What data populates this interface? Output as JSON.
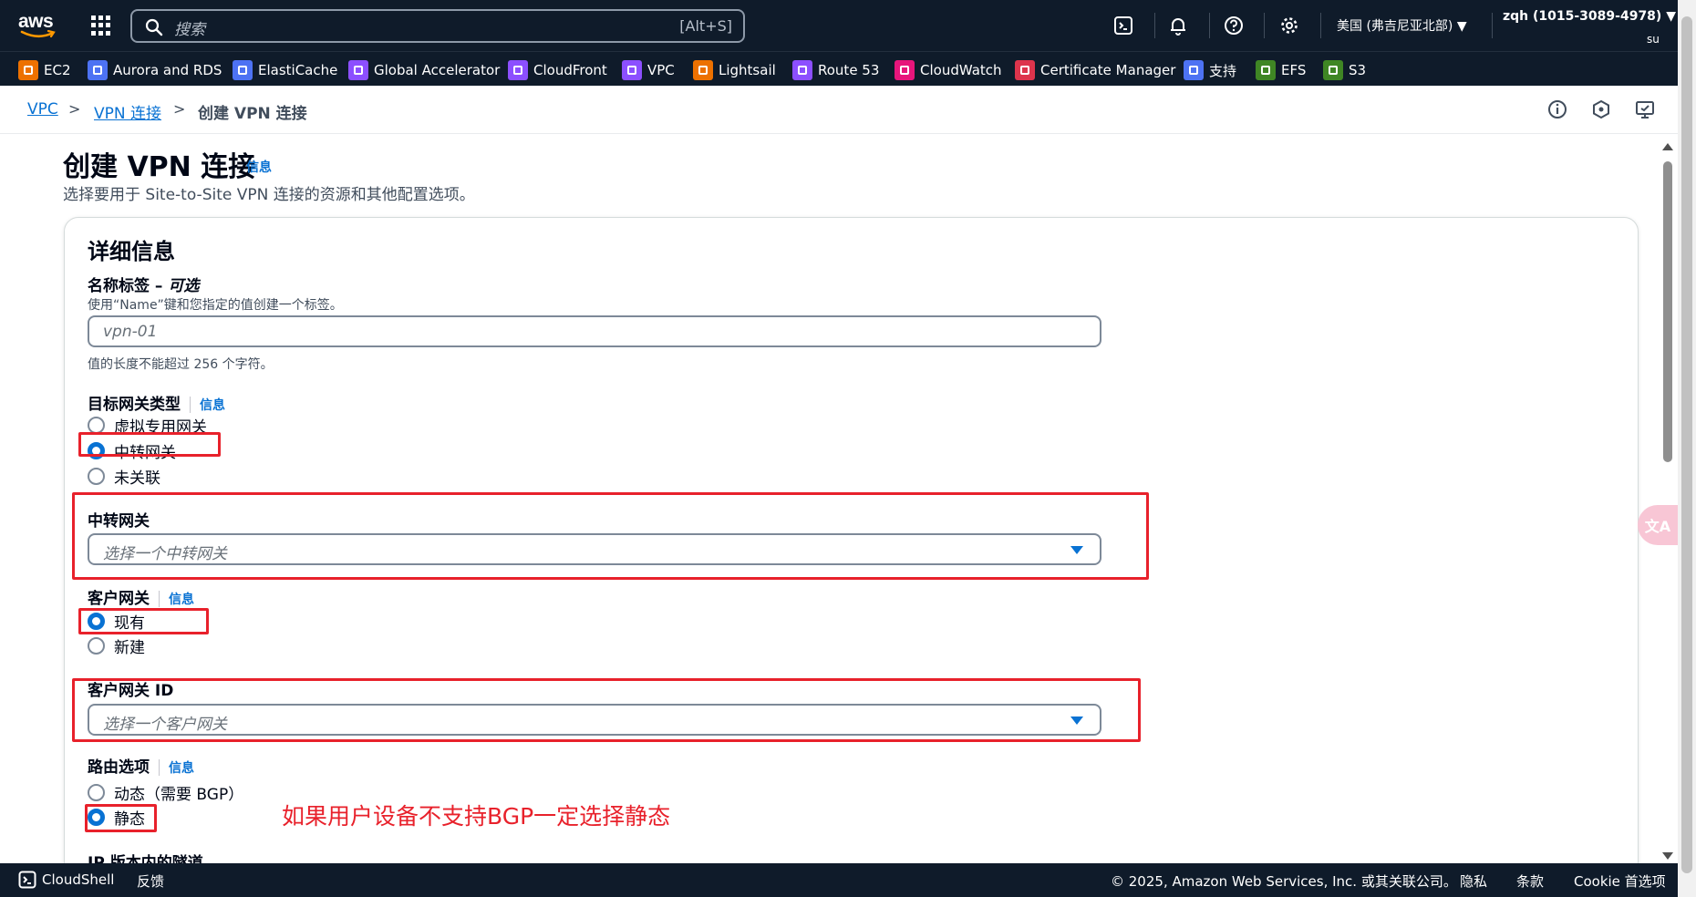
{
  "topnav": {
    "logo_text": "aws",
    "search_placeholder": "搜索",
    "search_shortcut": "[Alt+S]",
    "icons": [
      "cloudshell-icon",
      "bell-icon",
      "help-icon",
      "settings-icon"
    ],
    "region": "美国 (弗吉尼亚北部) ▼",
    "account": "zqh (1015-3089-4978) ▼",
    "account_sub": "su"
  },
  "servicebar": {
    "items": [
      {
        "label": "EC2",
        "color": "#ed7100"
      },
      {
        "label": "Aurora and RDS",
        "color": "#4d72f3"
      },
      {
        "label": "ElastiCache",
        "color": "#4d72f3"
      },
      {
        "label": "Global Accelerator",
        "color": "#8c4fff"
      },
      {
        "label": "CloudFront",
        "color": "#8c4fff"
      },
      {
        "label": "VPC",
        "color": "#8c4fff"
      },
      {
        "label": "Lightsail",
        "color": "#ed7100"
      },
      {
        "label": "Route 53",
        "color": "#8c4fff"
      },
      {
        "label": "CloudWatch",
        "color": "#e7157b"
      },
      {
        "label": "Certificate Manager",
        "color": "#dd344c"
      },
      {
        "label": "支持",
        "color": "#4d72f3"
      },
      {
        "label": "EFS",
        "color": "#3f8624"
      },
      {
        "label": "S3",
        "color": "#3f8624"
      }
    ]
  },
  "breadcrumb": {
    "items": [
      "VPC",
      "VPN 连接",
      "创建 VPN 连接"
    ],
    "separator": ">"
  },
  "page": {
    "title": "创建 VPN 连接",
    "info": "信息",
    "description": "选择要用于 Site-to-Site VPN 连接的资源和其他配置选项。"
  },
  "details": {
    "title": "详细信息",
    "name_tag": {
      "label": "名称标签 – ",
      "label_optional": "可选",
      "description": "使用“Name”键和您指定的值创建一个标签。",
      "placeholder": "vpn-01",
      "constraint": "值的长度不能超过 256 个字符。"
    },
    "target_gateway_type": {
      "label": "目标网关类型",
      "info": "信息",
      "options": [
        "虚拟专用网关",
        "中转网关",
        "未关联"
      ],
      "selected": "中转网关"
    },
    "transit_gateway": {
      "label": "中转网关",
      "placeholder": "选择一个中转网关"
    },
    "customer_gateway": {
      "label": "客户网关",
      "info": "信息",
      "options": [
        "现有",
        "新建"
      ],
      "selected": "现有"
    },
    "customer_gateway_id": {
      "label": "客户网关 ID",
      "placeholder": "选择一个客户网关"
    },
    "routing_options": {
      "label": "路由选项",
      "info": "信息",
      "options": [
        "动态（需要 BGP）",
        "静态"
      ],
      "selected": "静态"
    },
    "next_section_label": "IP 版本内的隧道"
  },
  "annotation": "如果用户设备不支持BGP一定选择静态",
  "translate_button": "文A",
  "footer": {
    "cloudshell": "CloudShell",
    "feedback": "反馈",
    "copyright": "© 2025, Amazon Web Services, Inc. 或其关联公司。",
    "privacy": "隐私",
    "terms": "条款",
    "cookie": "Cookie 首选项"
  },
  "colors": {
    "nav_bg": "#0f1b2a",
    "link": "#0972d3",
    "annotation": "#e8212b"
  }
}
